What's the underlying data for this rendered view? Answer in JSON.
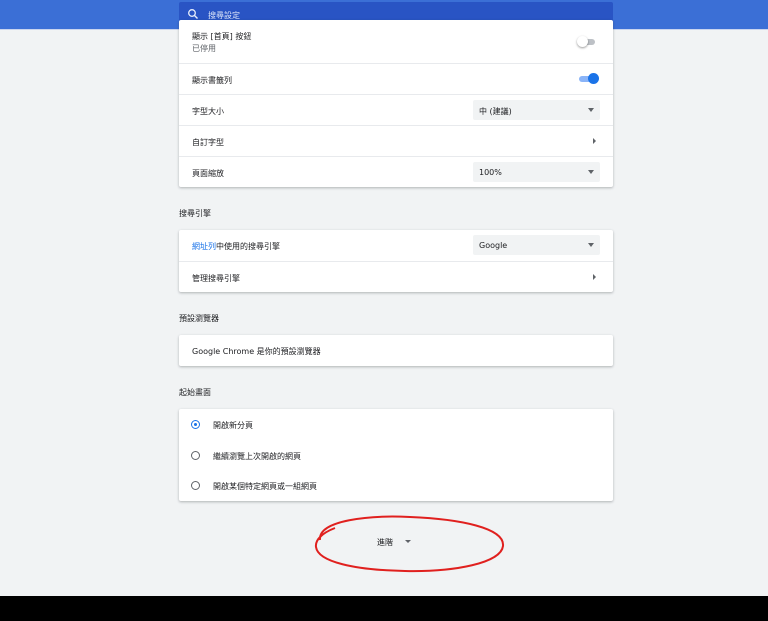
{
  "search": {
    "placeholder": "搜尋設定"
  },
  "appearance": {
    "home_button": {
      "label": "顯示 [首頁] 按鈕",
      "sublabel": "已停用",
      "enabled": false
    },
    "bookmarks_bar": {
      "label": "顯示書籤列",
      "enabled": true
    },
    "font_size": {
      "label": "字型大小",
      "value": "中 (建議)"
    },
    "custom_fonts": {
      "label": "自訂字型"
    },
    "page_zoom": {
      "label": "頁面縮放",
      "value": "100%"
    }
  },
  "search_engine": {
    "title": "搜尋引擎",
    "address_bar_link": "網址列",
    "address_bar_rest": "中使用的搜尋引擎",
    "engine_value": "Google",
    "manage_label": "管理搜尋引擎"
  },
  "default_browser": {
    "title": "預設瀏覽器",
    "text": "Google Chrome 是你的預設瀏覽器"
  },
  "on_startup": {
    "title": "起始畫面",
    "options": [
      {
        "label": "開啟新分頁",
        "checked": true
      },
      {
        "label": "繼續瀏覽上次開啟的網頁",
        "checked": false
      },
      {
        "label": "開啟某個特定網頁或一組網頁",
        "checked": false
      }
    ]
  },
  "advanced": {
    "label": "進階"
  },
  "colors": {
    "accent": "#1a73e8",
    "topbar": "#3b6fd6",
    "annotation": "#e0201e"
  }
}
